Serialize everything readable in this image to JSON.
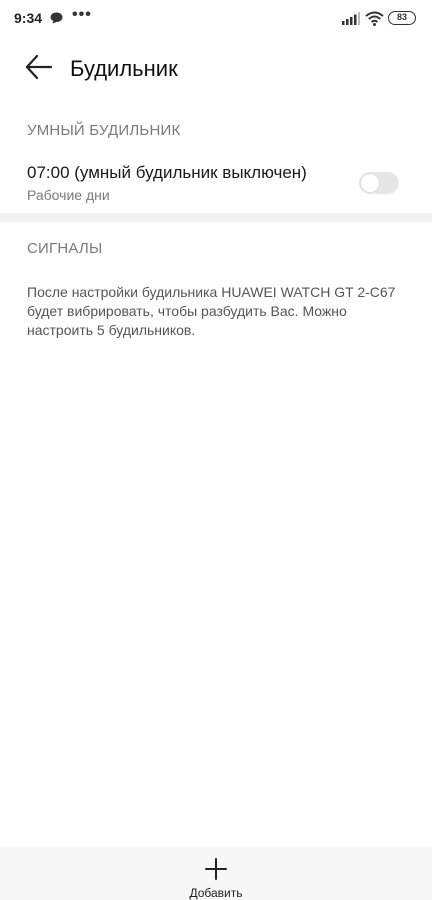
{
  "status_bar": {
    "time": "9:34",
    "more": "•••",
    "battery": "83",
    "icons": [
      "chat-icon",
      "more-icon",
      "signal-icon",
      "wifi-icon",
      "battery-icon"
    ]
  },
  "header": {
    "title": "Будильник",
    "back_icon": "arrow-left-icon"
  },
  "smart_alarm": {
    "section_title": "УМНЫЙ БУДИЛЬНИК",
    "item": {
      "title": "07:00 (умный будильник выключен)",
      "subtitle": "Рабочие дни",
      "enabled": false
    }
  },
  "signals": {
    "section_title": "СИГНАЛЫ",
    "description": "После настройки будильника HUAWEI WATCH GT 2-C67 будет вибрировать, чтобы разбудить Вас. Можно настроить 5 будильников."
  },
  "bottom_bar": {
    "add_label": "Добавить",
    "add_icon": "plus-icon"
  }
}
